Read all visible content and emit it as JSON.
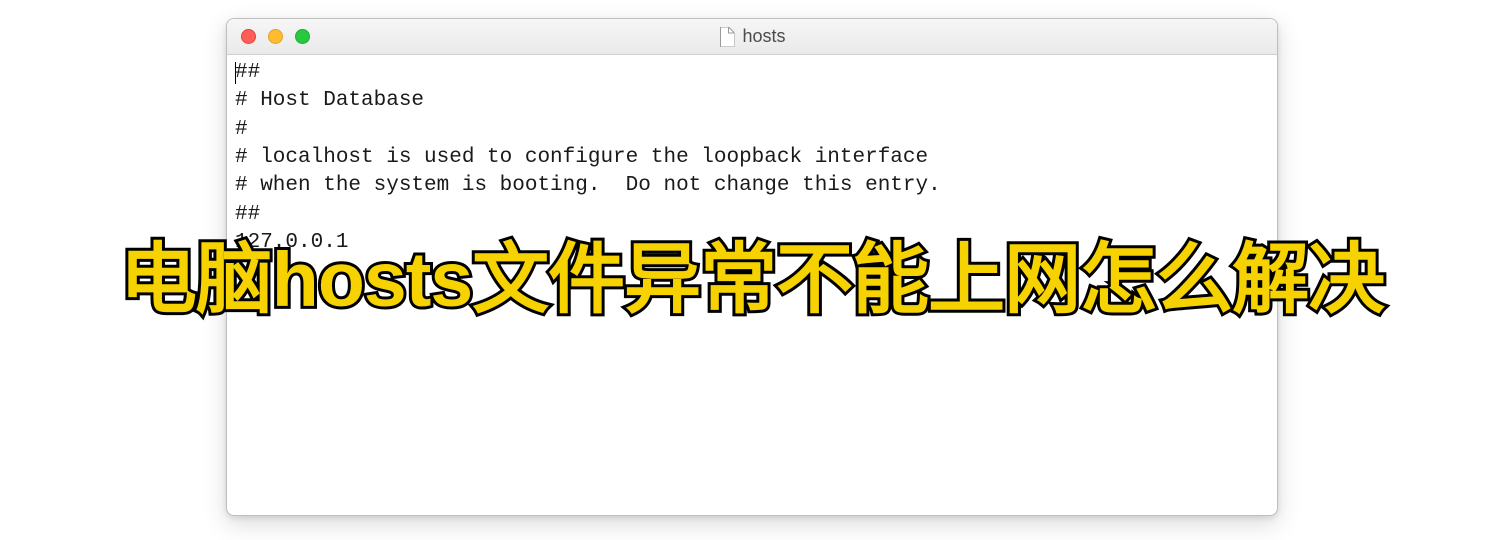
{
  "window": {
    "title": "hosts",
    "traffic_lights": {
      "close": "close",
      "minimize": "minimize",
      "zoom": "zoom"
    }
  },
  "editor": {
    "lines": [
      "##",
      "# Host Database",
      "#",
      "# localhost is used to configure the loopback interface",
      "# when the system is booting.  Do not change this entry.",
      "##",
      "127.0.0.1"
    ]
  },
  "overlay": {
    "text": "电脑hosts文件异常不能上网怎么解决"
  }
}
